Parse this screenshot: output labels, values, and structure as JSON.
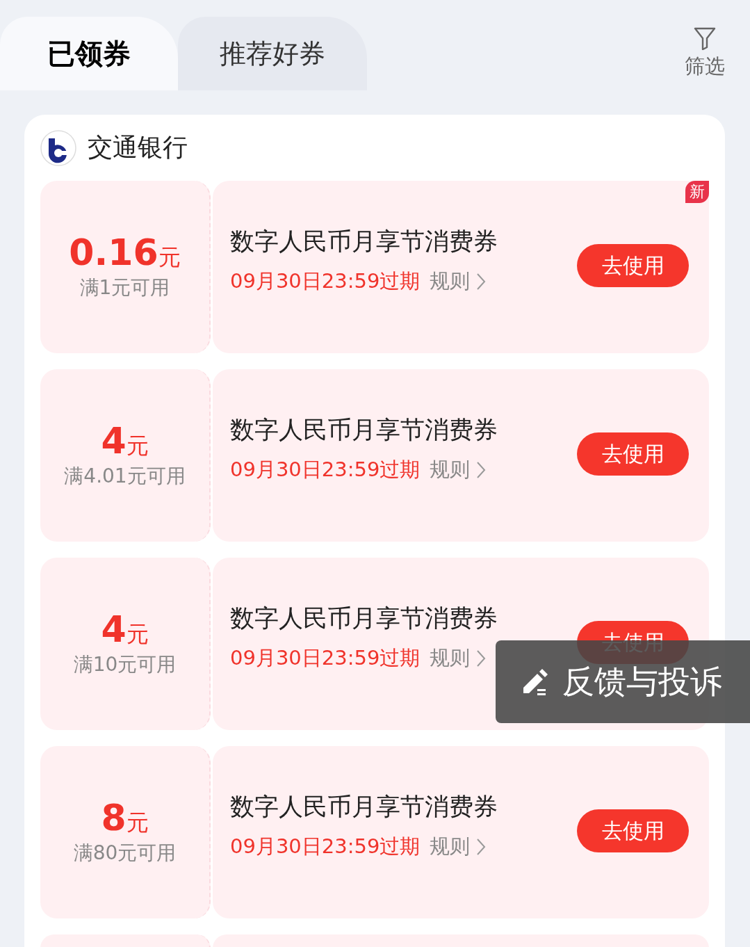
{
  "tabs": [
    {
      "label": "已领券",
      "selected": true
    },
    {
      "label": "推荐好券",
      "selected": false
    }
  ],
  "filter": {
    "label": "筛选"
  },
  "bank": {
    "name": "交通银行"
  },
  "coupons": [
    {
      "amount": "0.16",
      "unit": "元",
      "condition": "满1元可用",
      "title": "数字人民币月享节消费券",
      "expiry": "09月30日23:59过期",
      "rules": "规则",
      "button": "去使用",
      "badge": "新"
    },
    {
      "amount": "4",
      "unit": "元",
      "condition": "满4.01元可用",
      "title": "数字人民币月享节消费券",
      "expiry": "09月30日23:59过期",
      "rules": "规则",
      "button": "去使用"
    },
    {
      "amount": "4",
      "unit": "元",
      "condition": "满10元可用",
      "title": "数字人民币月享节消费券",
      "expiry": "09月30日23:59过期",
      "rules": "规则",
      "button": "去使用"
    },
    {
      "amount": "8",
      "unit": "元",
      "condition": "满80元可用",
      "title": "数字人民币月享节消费券",
      "expiry": "09月30日23:59过期",
      "rules": "规则",
      "button": "去使用"
    }
  ],
  "toast": {
    "label": "反馈与投诉"
  }
}
